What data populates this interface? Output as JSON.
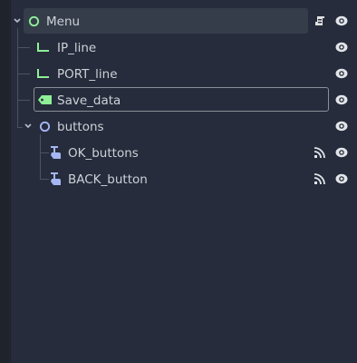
{
  "scene_tree": {
    "root": {
      "label": "Menu",
      "icon": "node-icon"
    },
    "children": [
      {
        "label": "IP_line",
        "icon": "line-edit-icon"
      },
      {
        "label": "PORT_line",
        "icon": "line-edit-icon"
      },
      {
        "label": "Save_data",
        "icon": "label-icon",
        "renaming": true
      },
      {
        "label": "buttons",
        "icon": "node2d-icon",
        "expanded": true
      },
      {
        "label": "OK_buttons",
        "icon": "texture-button-icon",
        "has_signals": true
      },
      {
        "label": "BACK_button",
        "icon": "texture-button-icon",
        "has_signals": true
      }
    ]
  },
  "colors": {
    "accent_green": "#8eef97",
    "accent_blue": "#a5b7f3",
    "background": "#262c3b"
  }
}
